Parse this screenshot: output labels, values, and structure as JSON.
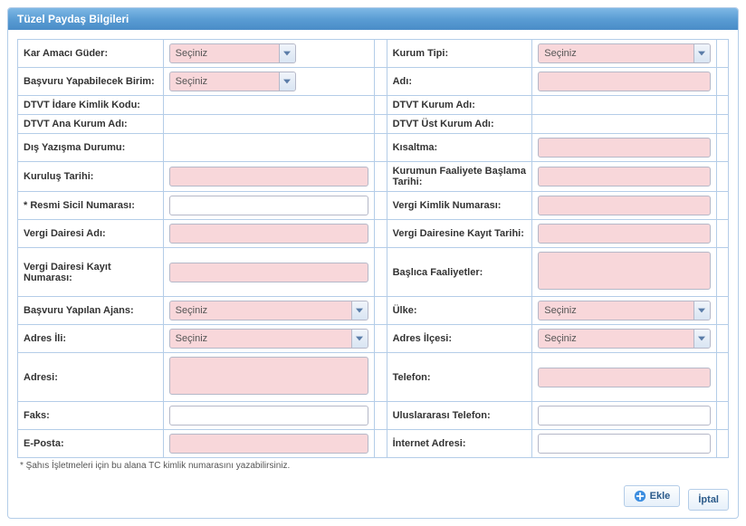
{
  "header": {
    "title": "Tüzel Paydaş Bilgileri"
  },
  "common": {
    "secinizPlaceholder": "Seçiniz"
  },
  "labels": {
    "karAmaci": "Kar Amacı Güder:",
    "kurumTipi": "Kurum Tipi:",
    "basvuruBirimi": "Başvuru Yapabilecek Birim:",
    "adi": "Adı:",
    "dtvtIdare": "DTVT İdare Kimlik Kodu:",
    "dtvtKurum": "DTVT Kurum Adı:",
    "dtvtAnaKurum": "DTVT Ana Kurum Adı:",
    "dtvtUstKurum": "DTVT Üst Kurum Adı:",
    "disYazisma": "Dış Yazışma Durumu:",
    "kisaltma": "Kısaltma:",
    "kurulusTarihi": "Kuruluş Tarihi:",
    "faaliyetBaslama": "Kurumun Faaliyete Başlama Tarihi:",
    "resmiSicil": "* Resmi Sicil Numarası:",
    "vergiKimlik": "Vergi Kimlik Numarası:",
    "vergiDairesiAdi": "Vergi Dairesi Adı:",
    "vergiKayitTarihi": "Vergi Dairesine Kayıt Tarihi:",
    "vergiKayitNo": "Vergi Dairesi Kayıt Numarası:",
    "baslicaFaaliyetler": "Başlıca Faaliyetler:",
    "basvuruAjans": "Başvuru Yapılan Ajans:",
    "ulke": "Ülke:",
    "adresIli": "Adres İli:",
    "adresIlcesi": "Adres İlçesi:",
    "adresi": "Adresi:",
    "telefon": "Telefon:",
    "faks": "Faks:",
    "uluslararasiTel": "Uluslararası Telefon:",
    "eposta": "E-Posta:",
    "internetAdresi": "İnternet Adresi:"
  },
  "footnote": "* Şahıs İşletmeleri için bu alana TC kimlik numarasını yazabilirsiniz.",
  "buttons": {
    "ekle": "Ekle",
    "iptal": "İptal"
  }
}
